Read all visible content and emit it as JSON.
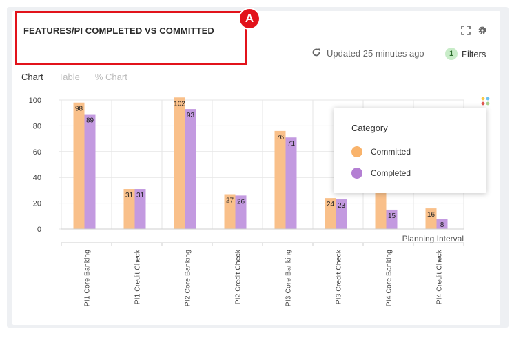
{
  "header": {
    "title": "FEATURES/PI COMPLETED VS COMMITTED",
    "badge": "A",
    "updated": "Updated 25 minutes ago",
    "filters_count": "1",
    "filters_label": "Filters"
  },
  "tabs": [
    {
      "label": "Chart",
      "active": true
    },
    {
      "label": "Table",
      "active": false
    },
    {
      "label": "% Chart",
      "active": false
    }
  ],
  "legend": {
    "title": "Category",
    "items": [
      {
        "label": "Committed",
        "color": "#f9b36b"
      },
      {
        "label": "Completed",
        "color": "#b47fd3"
      }
    ]
  },
  "chart_data": {
    "type": "bar",
    "categories": [
      "PI1 Core Banking",
      "PI1 Credit Check",
      "PI2 Core Banking",
      "PI2 Credit Check",
      "PI3 Core Banking",
      "PI3 Credit Check",
      "PI4 Core Banking",
      "PI4 Credit Check"
    ],
    "series": [
      {
        "name": "Committed",
        "values": [
          98,
          31,
          102,
          27,
          76,
          24,
          35,
          16
        ],
        "color": "#f9c08a",
        "labels": [
          "98",
          "31",
          "102",
          "27",
          "76",
          "24",
          "",
          "16"
        ]
      },
      {
        "name": "Completed",
        "values": [
          89,
          31,
          93,
          26,
          71,
          23,
          15,
          8
        ],
        "color": "#c39ae0",
        "labels": [
          "89",
          "31",
          "93",
          "26",
          "71",
          "23",
          "15",
          "8"
        ]
      }
    ],
    "xlabel": "Planning Interval",
    "ylabel": "",
    "yticks": [
      "100",
      "80",
      "60",
      "40",
      "20",
      "0"
    ],
    "ylim": [
      0,
      100
    ],
    "grid": true,
    "legend_position": "right"
  }
}
